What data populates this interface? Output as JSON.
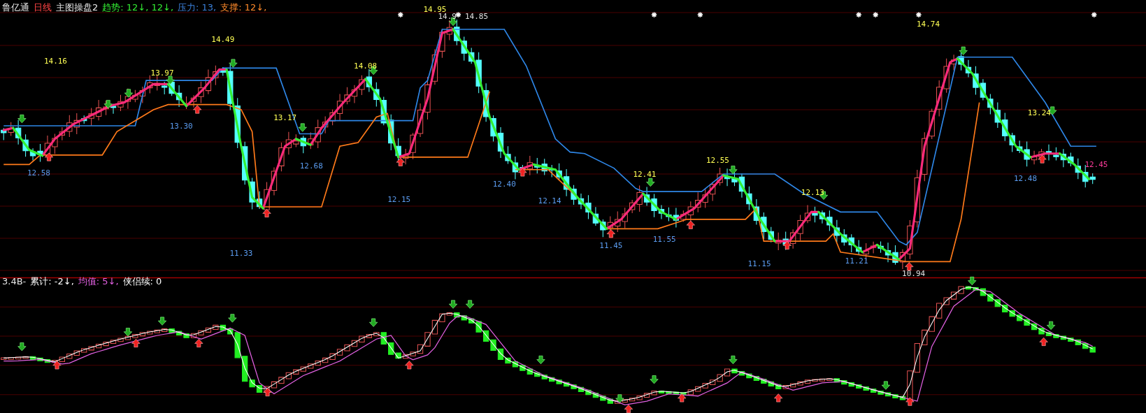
{
  "main_panel": {
    "stock_name": "鲁亿通",
    "period": "日线",
    "formula": "主图操盘2",
    "indicators": [
      {
        "kind": "trend",
        "text": "趋势: 12↓, 12↓,"
      },
      {
        "kind": "pressure",
        "text": "压力: 13,"
      },
      {
        "kind": "support",
        "text": "支撑: 12↓,"
      }
    ],
    "price_labels": [
      {
        "kind": "high",
        "text": "14.16"
      },
      {
        "kind": "low",
        "text": "12.58"
      },
      {
        "kind": "high",
        "text": "13.97"
      },
      {
        "kind": "low",
        "text": "13.30"
      },
      {
        "kind": "high",
        "text": "14.49"
      },
      {
        "kind": "low",
        "text": "11.33"
      },
      {
        "kind": "high",
        "text": "13.17"
      },
      {
        "kind": "low",
        "text": "12.68"
      },
      {
        "kind": "high",
        "text": "14.08"
      },
      {
        "kind": "low",
        "text": "12.15"
      },
      {
        "kind": "high",
        "text": "14.95"
      },
      {
        "kind": "mark",
        "text": "14.9"
      },
      {
        "kind": "mark",
        "text": "14.85"
      },
      {
        "kind": "low",
        "text": "12.40"
      },
      {
        "kind": "low",
        "text": "12.14"
      },
      {
        "kind": "low",
        "text": "11.45"
      },
      {
        "kind": "high",
        "text": "12.41"
      },
      {
        "kind": "low",
        "text": "11.55"
      },
      {
        "kind": "high",
        "text": "12.55"
      },
      {
        "kind": "low",
        "text": "11.15"
      },
      {
        "kind": "high",
        "text": "12.13"
      },
      {
        "kind": "low",
        "text": "11.21"
      },
      {
        "kind": "mark",
        "text": "10.94"
      },
      {
        "kind": "high",
        "text": "14.74"
      },
      {
        "kind": "low",
        "text": "12.48"
      },
      {
        "kind": "high",
        "text": "13.24"
      },
      {
        "kind": "last",
        "text": "12.45"
      }
    ]
  },
  "sub_panel": {
    "indicator": "3.4B-",
    "values": [
      {
        "kind": "total",
        "text": "累计: -2↓,"
      },
      {
        "kind": "average",
        "text": "均值: 5↓,"
      },
      {
        "kind": "streak",
        "text": "侠侣续: 0"
      }
    ]
  }
}
